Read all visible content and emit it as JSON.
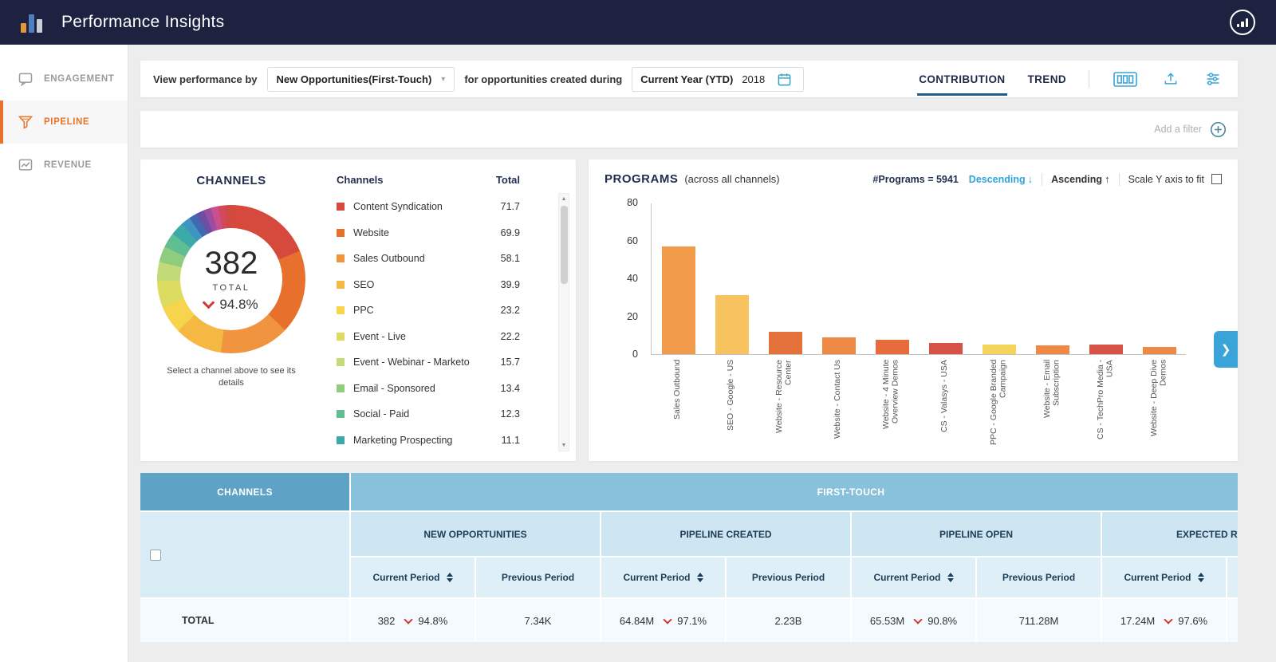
{
  "header": {
    "title": "Performance Insights"
  },
  "sidebar": {
    "items": [
      {
        "label": "ENGAGEMENT",
        "icon": "engagement-icon",
        "active": false
      },
      {
        "label": "PIPELINE",
        "icon": "pipeline-funnel-icon",
        "active": true
      },
      {
        "label": "REVENUE",
        "icon": "revenue-chart-icon",
        "active": false
      }
    ]
  },
  "toolbar": {
    "view_by_label": "View performance by",
    "view_by_value": "New Opportunities(First-Touch)",
    "during_label": "for opportunities created during",
    "period_label": "Current Year (YTD)",
    "period_year": "2018",
    "tab_contribution": "CONTRIBUTION",
    "tab_trend": "TREND"
  },
  "filter_bar": {
    "add_filter": "Add a filter"
  },
  "channels": {
    "title": "CHANNELS",
    "donut": {
      "total": "382",
      "total_label": "TOTAL",
      "delta": "94.8%"
    },
    "hint": "Select a channel above to see its details",
    "list_header": {
      "name": "Channels",
      "total": "Total"
    },
    "chart_data": {
      "type": "pie",
      "title": "CHANNELS",
      "center_total": 382,
      "center_delta_pct": "94.8%",
      "items": [
        {
          "name": "Content Syndication",
          "value": 71.7,
          "color": "#d6493d"
        },
        {
          "name": "Website",
          "value": 69.9,
          "color": "#e8702d"
        },
        {
          "name": "Sales Outbound",
          "value": 58.1,
          "color": "#f0943f"
        },
        {
          "name": "SEO",
          "value": 39.9,
          "color": "#f4b843"
        },
        {
          "name": "PPC",
          "value": 23.2,
          "color": "#f6d44d"
        },
        {
          "name": "Event - Live",
          "value": 22.2,
          "color": "#dcdc60"
        },
        {
          "name": "Event - Webinar - Marketo",
          "value": 15.7,
          "color": "#c3da79"
        },
        {
          "name": "Email - Sponsored",
          "value": 13.4,
          "color": "#90cc7e"
        },
        {
          "name": "Social - Paid",
          "value": 12.3,
          "color": "#5fbf93"
        },
        {
          "name": "Marketing Prospecting",
          "value": 11.1,
          "color": "#3caaab"
        }
      ],
      "other_segments": [
        {
          "value": 8,
          "color": "#3f95c0"
        },
        {
          "value": 7,
          "color": "#4069b0"
        },
        {
          "value": 6.5,
          "color": "#6a4fa5"
        },
        {
          "value": 6,
          "color": "#9b4d9f"
        },
        {
          "value": 6,
          "color": "#c94f8e"
        },
        {
          "value": 5.5,
          "color": "#d1485f"
        },
        {
          "value": 5.5,
          "color": "#cf4a45"
        }
      ]
    }
  },
  "programs": {
    "title": "PROGRAMS",
    "subtitle": "(across all channels)",
    "count_label": "#Programs = 5941",
    "descending_label": "Descending",
    "ascending_label": "Ascending",
    "scale_label": "Scale Y axis to fit",
    "chart_data": {
      "type": "bar",
      "categories": [
        "Sales Outbound",
        "SEO - Google - US",
        "Website - Resource Center",
        "Website - Contact Us",
        "Website - 4 Minute Overview Demos",
        "CS - Valasys - USA",
        "PPC - Google Branded Campaign",
        "Website - Email Subscription",
        "CS - TechPro Media - USA",
        "Website - Deep Dive Demos"
      ],
      "values": [
        57,
        31,
        12,
        9,
        7.5,
        6,
        5,
        4.5,
        5,
        4
      ],
      "colors": [
        "#f29c4b",
        "#f7c35f",
        "#e4703a",
        "#ee8843",
        "#e86b3c",
        "#d75147",
        "#f5d45c",
        "#ee8843",
        "#d75147",
        "#ee8843"
      ],
      "ylim": [
        0,
        80
      ],
      "yticks": [
        0,
        20,
        40,
        60,
        80
      ],
      "sort": "descending",
      "legend": "none",
      "grid": "off"
    }
  },
  "table": {
    "corner_label": "CHANNELS",
    "span_label": "FIRST-TOUCH",
    "groups": [
      "NEW OPPORTUNITIES",
      "PIPELINE CREATED",
      "PIPELINE OPEN",
      "EXPECTED REVENUE"
    ],
    "period_cols": {
      "current": "Current Period",
      "previous": "Previous Period"
    },
    "rows": [
      {
        "label": "TOTAL",
        "cells": [
          {
            "value": "382",
            "delta": "94.8%",
            "direction": "down"
          },
          {
            "value": "7.34K"
          },
          {
            "value": "64.84M",
            "delta": "97.1%",
            "direction": "down"
          },
          {
            "value": "2.23B"
          },
          {
            "value": "65.53M",
            "delta": "90.8%",
            "direction": "down"
          },
          {
            "value": "711.28M"
          },
          {
            "value": "17.24M",
            "delta": "97.6%",
            "direction": "down"
          }
        ]
      }
    ]
  },
  "colors": {
    "header_bg": "#1c2240",
    "accent_orange": "#e8732a",
    "accent_blue": "#2fa3dc",
    "table_header_dark": "#5ea3c6",
    "table_header_light": "#8ac1da",
    "delta_red": "#cf3b30"
  }
}
